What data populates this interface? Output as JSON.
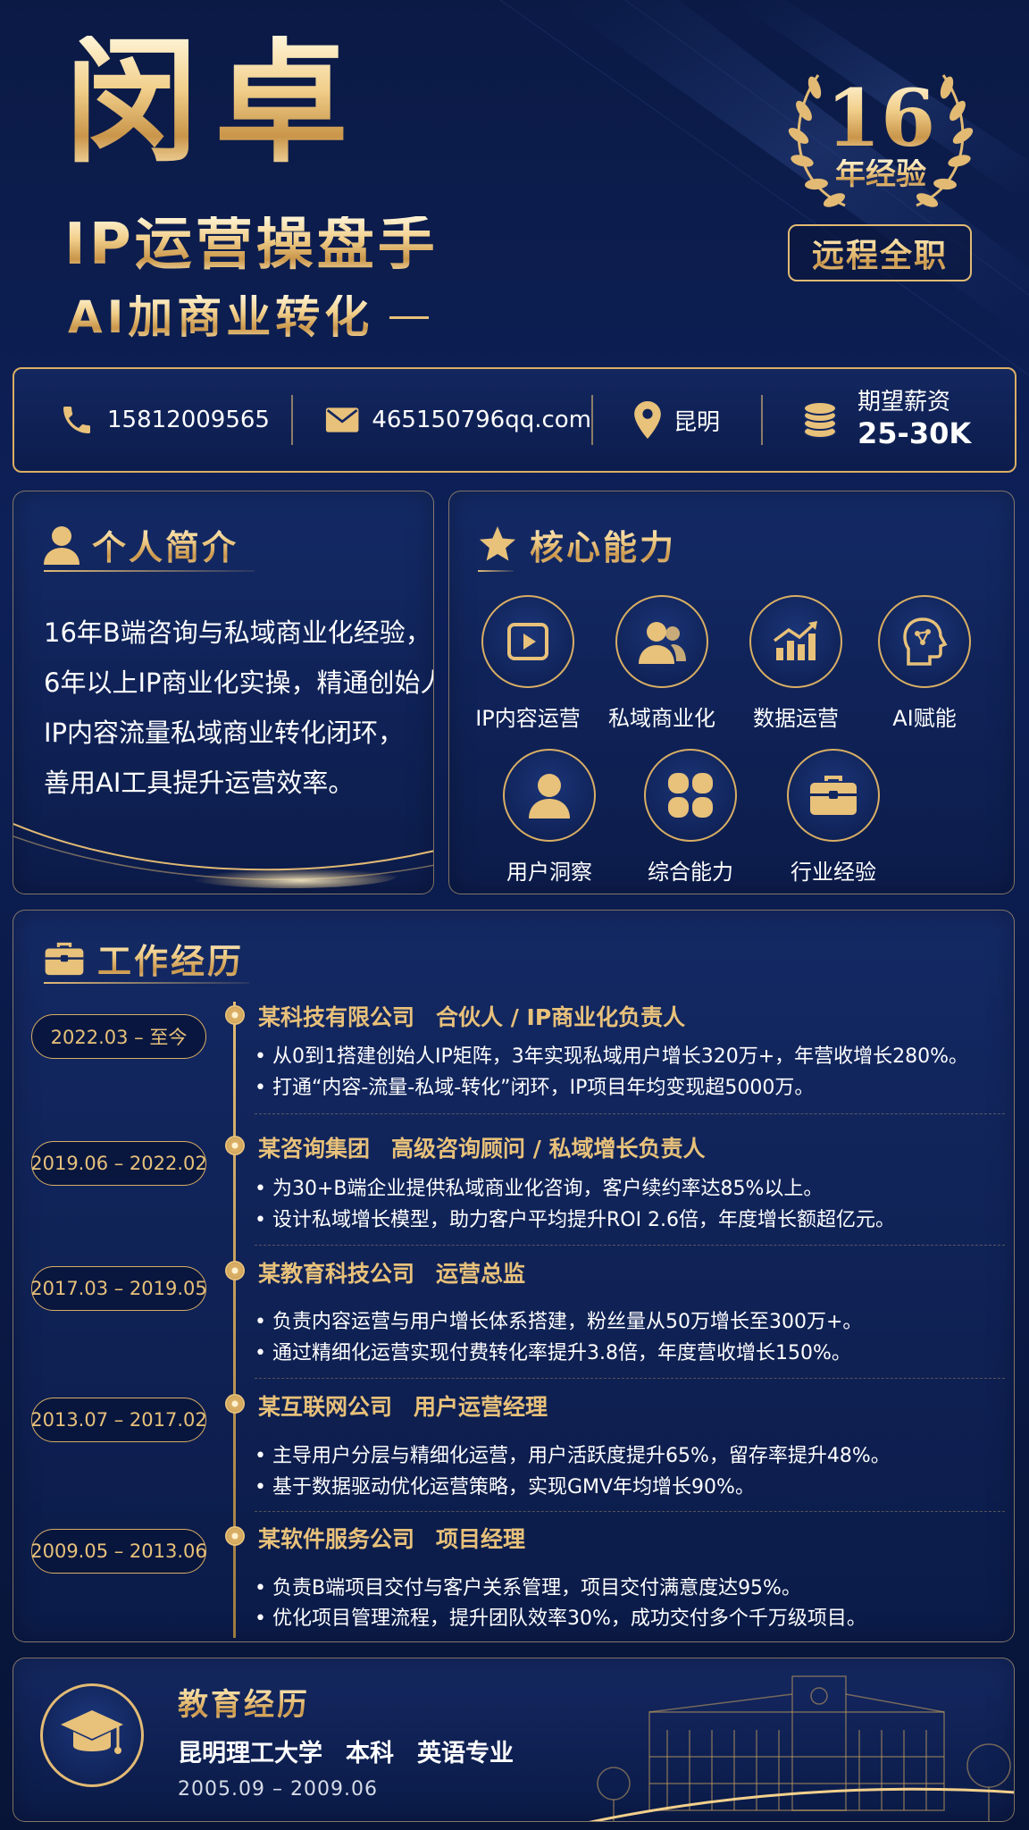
{
  "header": {
    "name": "闵卓",
    "title_line1": "IP运营操盘手",
    "title_line2": "AI加商业转化",
    "badge_number": "16",
    "badge_text": "年经验",
    "work_mode": "远程全职"
  },
  "contact": {
    "phone": "15812009565",
    "email": "465150796qq.com",
    "location": "昆明",
    "salary_label": "期望薪资",
    "salary_value": "25-30K"
  },
  "intro": {
    "heading": "个人简介",
    "lines": [
      "16年B端咨询与私域商业化经验，",
      "6年以上IP商业化实操，精通创始人",
      "IP内容流量私域商业转化闭环，",
      "善用AI工具提升运营效率。"
    ]
  },
  "skills": {
    "heading": "核心能力",
    "items": [
      {
        "label": "IP内容运营",
        "icon": "play-icon"
      },
      {
        "label": "私域商业化",
        "icon": "users-icon"
      },
      {
        "label": "数据运营",
        "icon": "chart-icon"
      },
      {
        "label": "AI赋能",
        "icon": "ai-head-icon"
      },
      {
        "label": "用户洞察",
        "icon": "user-icon"
      },
      {
        "label": "综合能力",
        "icon": "grid-icon"
      },
      {
        "label": "行业经验",
        "icon": "briefcase-icon"
      }
    ]
  },
  "work": {
    "heading": "工作经历",
    "jobs": [
      {
        "date": "2022.03 – 至今",
        "company": "某科技有限公司",
        "role": "合伙人 / IP商业化负责人",
        "bullets": [
          "• 从0到1搭建创始人IP矩阵，3年实现私域用户增长320万+，年营收增长280%。",
          "• 打通“内容-流量-私域-转化”闭环，IP项目年均变现超5000万。"
        ]
      },
      {
        "date": "2019.06 – 2022.02",
        "company": "某咨询集团",
        "role": "高级咨询顾问 / 私域增长负责人",
        "bullets": [
          "• 为30+B端企业提供私域商业化咨询，客户续约率达85%以上。",
          "• 设计私域增长模型，助力客户平均提升ROI 2.6倍，年度增长额超亿元。"
        ]
      },
      {
        "date": "2017.03 – 2019.05",
        "company": "某教育科技公司",
        "role": "运营总监",
        "bullets": [
          "• 负责内容运营与用户增长体系搭建，粉丝量从50万增长至300万+。",
          "• 通过精细化运营实现付费转化率提升3.8倍，年度营收增长150%。"
        ]
      },
      {
        "date": "2013.07 – 2017.02",
        "company": "某互联网公司",
        "role": "用户运营经理",
        "bullets": [
          "• 主导用户分层与精细化运营，用户活跃度提升65%，留存率提升48%。",
          "• 基于数据驱动优化运营策略，实现GMV年均增长90%。"
        ]
      },
      {
        "date": "2009.05 – 2013.06",
        "company": "某软件服务公司",
        "role": "项目经理",
        "bullets": [
          "• 负责B端项目交付与客户关系管理，项目交付满意度达95%。",
          "• 优化项目管理流程，提升团队效率30%，成功交付多个千万级项目。"
        ]
      }
    ]
  },
  "education": {
    "heading": "教育经历",
    "school": "昆明理工大学",
    "degree": "本科",
    "major": "英语专业",
    "dates": "2005.09 – 2009.06"
  }
}
